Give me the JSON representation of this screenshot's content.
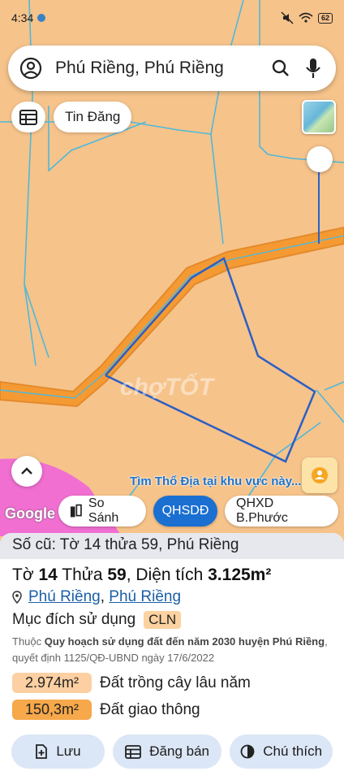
{
  "status_bar": {
    "time": "4:34",
    "battery": "62"
  },
  "search": {
    "query": "Phú Riềng, Phú Riềng"
  },
  "top_chips": {
    "tin_dang": "Tin Đăng"
  },
  "map": {
    "watermark": "chợTỐT",
    "find_hint": "Tìm Thổ Địa tại khu vực này...",
    "google_logo": "Google",
    "colors": {
      "land": "#f6c38b",
      "road": "#f59a33",
      "parcel": "#2b5fc4",
      "boundary": "#4fb9d9",
      "pink_zone": "#f06fd1"
    }
  },
  "layer_tabs": [
    {
      "label": "So Sánh",
      "active": false
    },
    {
      "label": "QHSDĐ",
      "active": true
    },
    {
      "label": "QHXD B.Phước",
      "active": false
    }
  ],
  "sheet": {
    "old_number": "Số cũ: Tờ 14 thửa 59, Phú Riềng",
    "to_label": "Tờ",
    "to_value": "14",
    "thua_label": "Thửa",
    "thua_value": "59",
    "dien_tich_label": ", Diện tích",
    "dien_tich_value": "3.125m²",
    "location_1": "Phú Riềng",
    "location_sep": ",",
    "location_2": "Phú Riềng",
    "purpose_label": "Mục đích sử dụng",
    "purpose_code": "CLN",
    "note_prefix": "Thuộc",
    "note_bold": "Quy hoạch sử dụng đất đến năm 2030 huyện Phú Riềng",
    "note_suffix": ", quyết định 1125/QĐ-UBND ngày 17/6/2022",
    "areas": [
      {
        "size": "2.974m²",
        "label": "Đất trồng cây lâu năm",
        "color": "#fcd0a2"
      },
      {
        "size": "150,3m²",
        "label": "Đất giao thông",
        "color": "#f6a84a"
      }
    ],
    "actions": {
      "save": "Lưu",
      "post": "Đăng bán",
      "legend": "Chú thích"
    }
  }
}
